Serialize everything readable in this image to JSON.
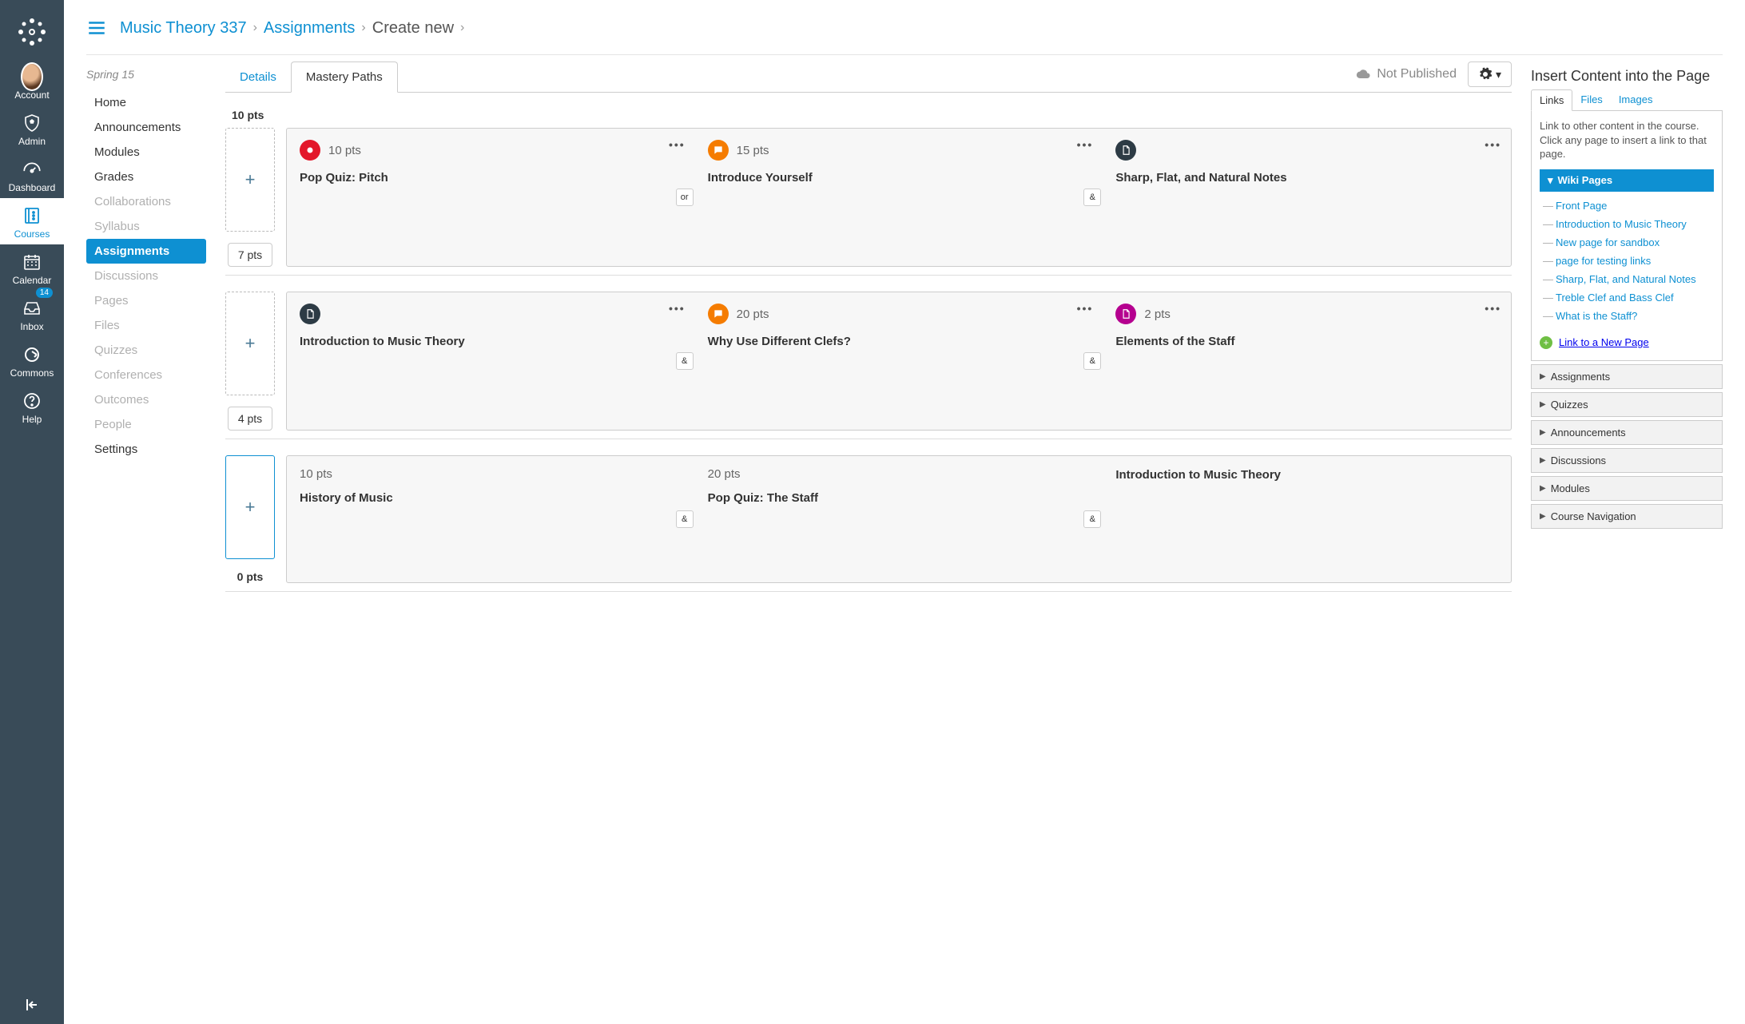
{
  "globalNav": {
    "items": [
      {
        "key": "account",
        "label": "Account"
      },
      {
        "key": "admin",
        "label": "Admin"
      },
      {
        "key": "dashboard",
        "label": "Dashboard"
      },
      {
        "key": "courses",
        "label": "Courses"
      },
      {
        "key": "calendar",
        "label": "Calendar"
      },
      {
        "key": "inbox",
        "label": "Inbox",
        "badge": "14"
      },
      {
        "key": "commons",
        "label": "Commons"
      },
      {
        "key": "help",
        "label": "Help"
      }
    ]
  },
  "breadcrumb": {
    "course": "Music Theory 337",
    "section": "Assignments",
    "page": "Create new"
  },
  "courseNav": {
    "term": "Spring 15",
    "items": [
      {
        "label": "Home"
      },
      {
        "label": "Announcements"
      },
      {
        "label": "Modules"
      },
      {
        "label": "Grades"
      },
      {
        "label": "Collaborations",
        "dim": true
      },
      {
        "label": "Syllabus",
        "dim": true
      },
      {
        "label": "Assignments",
        "active": true
      },
      {
        "label": "Discussions",
        "dim": true
      },
      {
        "label": "Pages",
        "dim": true
      },
      {
        "label": "Files",
        "dim": true
      },
      {
        "label": "Quizzes",
        "dim": true
      },
      {
        "label": "Conferences",
        "dim": true
      },
      {
        "label": "Outcomes",
        "dim": true
      },
      {
        "label": "People",
        "dim": true
      },
      {
        "label": "Settings"
      }
    ]
  },
  "tabs": {
    "details": "Details",
    "mastery": "Mastery Paths"
  },
  "status": {
    "notPublished": "Not Published"
  },
  "paths": [
    {
      "scoreLabel": "10 pts",
      "rangeBelow": "7 pts",
      "cards": [
        {
          "iconColor": "red",
          "iconType": "record",
          "pts": "10 pts",
          "title": "Pop Quiz: Pitch",
          "connector": "or"
        },
        {
          "iconColor": "orange",
          "iconType": "chat",
          "pts": "15 pts",
          "title": "Introduce Yourself",
          "connector": "&"
        },
        {
          "iconColor": "dark",
          "iconType": "doc",
          "pts": "",
          "title": "Sharp, Flat, and Natural Notes"
        }
      ]
    },
    {
      "scoreLabel": "",
      "rangeBelow": "4 pts",
      "cards": [
        {
          "iconColor": "dark",
          "iconType": "doc",
          "pts": "",
          "title": "Introduction to Music Theory",
          "connector": "&"
        },
        {
          "iconColor": "orange",
          "iconType": "chat",
          "pts": "20 pts",
          "title": "Why Use Different Clefs?",
          "connector": "&"
        },
        {
          "iconColor": "magenta",
          "iconType": "doc",
          "pts": "2 pts",
          "title": "Elements of the Staff"
        }
      ]
    },
    {
      "scoreLabel": "",
      "rangeBelow": "0 pts",
      "rangeBelowStyle": "text",
      "dropzoneSelected": true,
      "cards": [
        {
          "iconColor": "",
          "iconType": "",
          "pts": "10 pts",
          "title": "History of Music",
          "connector": "&"
        },
        {
          "iconColor": "",
          "iconType": "",
          "pts": "20 pts",
          "title": "Pop Quiz: The Staff",
          "connector": "&"
        },
        {
          "iconColor": "",
          "iconType": "",
          "pts": "",
          "title": "Introduction to Music Theory"
        }
      ]
    }
  ],
  "rside": {
    "title": "Insert Content into the Page",
    "tabs": {
      "links": "Links",
      "files": "Files",
      "images": "Images"
    },
    "hint": "Link to other content in the course. Click any page to insert a link to that page.",
    "wikiHeader": "Wiki Pages",
    "wikiPages": [
      "Front Page",
      "Introduction to Music Theory",
      "New page for sandbox",
      "page for testing links",
      "Sharp, Flat, and Natural Notes",
      "Treble Clef and Bass Clef",
      "What is the Staff?"
    ],
    "newPageLabel": "Link to a New Page",
    "accordions": [
      "Assignments",
      "Quizzes",
      "Announcements",
      "Discussions",
      "Modules",
      "Course Navigation"
    ]
  }
}
